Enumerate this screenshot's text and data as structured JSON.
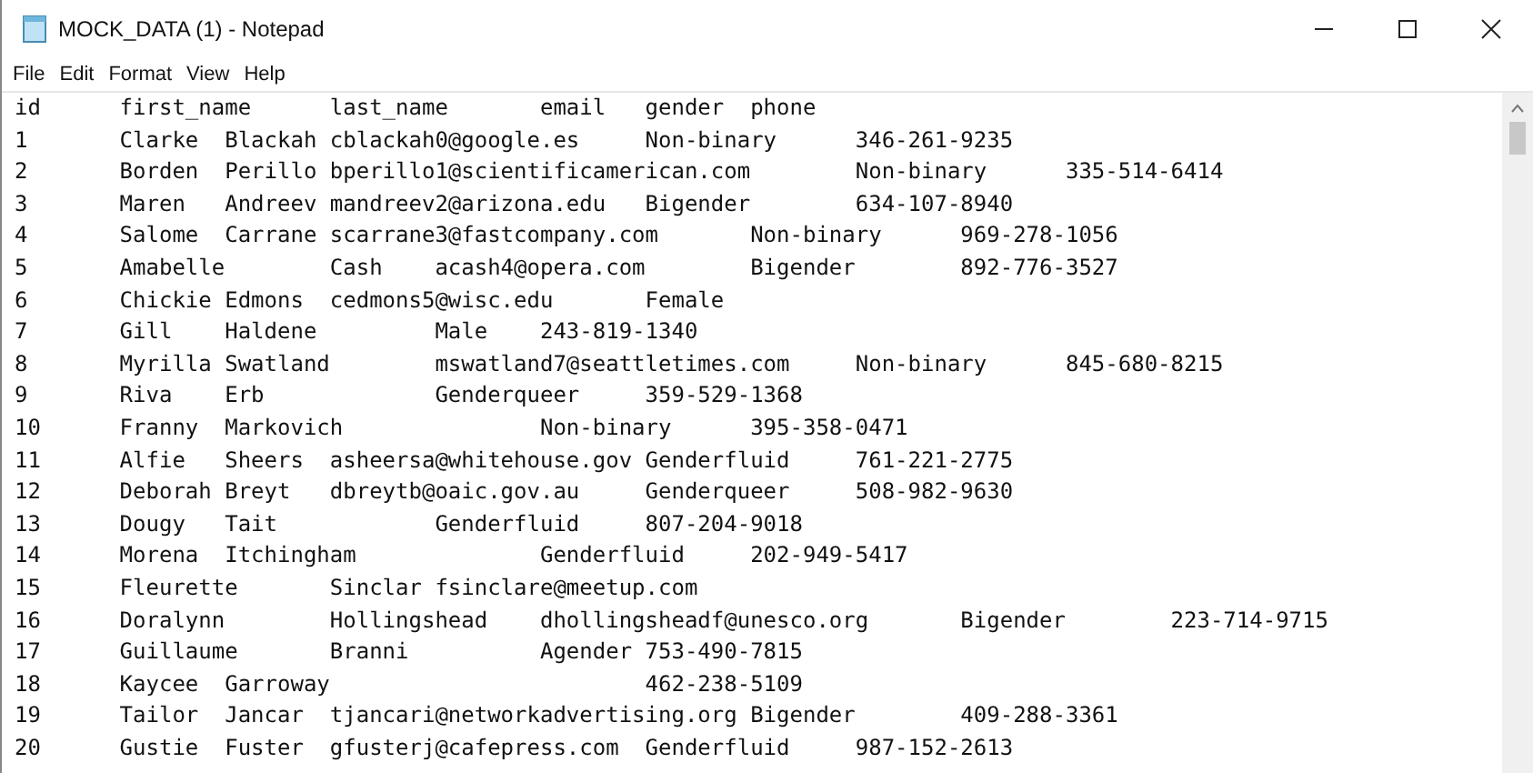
{
  "window": {
    "title": "MOCK_DATA (1) - Notepad"
  },
  "menu": [
    "File",
    "Edit",
    "Format",
    "View",
    "Help"
  ],
  "lines": [
    "id\tfirst_name\tlast_name\temail\tgender\tphone",
    "1\tClarke\tBlackah\tcblackah0@google.es\tNon-binary\t346-261-9235",
    "2\tBorden\tPerillo\tbperillo1@scientificamerican.com\tNon-binary\t335-514-6414",
    "3\tMaren\tAndreev\tmandreev2@arizona.edu\tBigender\t634-107-8940",
    "4\tSalome\tCarrane\tscarrane3@fastcompany.com\tNon-binary\t969-278-1056",
    "5\tAmabelle\tCash\tacash4@opera.com\tBigender\t892-776-3527",
    "6\tChickie\tEdmons\tcedmons5@wisc.edu\tFemale",
    "7\tGill\tHaldene\t\tMale\t243-819-1340",
    "8\tMyrilla\tSwatland\tmswatland7@seattletimes.com\tNon-binary\t845-680-8215",
    "9\tRiva\tErb\t\tGenderqueer\t359-529-1368",
    "10\tFranny\tMarkovich\t\tNon-binary\t395-358-0471",
    "11\tAlfie\tSheers\tasheersa@whitehouse.gov\tGenderfluid\t761-221-2775",
    "12\tDeborah\tBreyt\tdbreytb@oaic.gov.au\tGenderqueer\t508-982-9630",
    "13\tDougy\tTait\t\tGenderfluid\t807-204-9018",
    "14\tMorena\tItchingham\t\tGenderfluid\t202-949-5417",
    "15\tFleurette\tSinclar\tfsinclare@meetup.com",
    "16\tDoralynn\tHollingshead\tdhollingsheadf@unesco.org\tBigender\t223-714-9715",
    "17\tGuillaume\tBranni\t\tAgender\t753-490-7815",
    "18\tKaycee\tGarroway\t\t\t462-238-5109",
    "19\tTailor\tJancar\ttjancari@networkadvertising.org\tBigender\t409-288-3361",
    "20\tGustie\tFuster\tgfusterj@cafepress.com\tGenderfluid\t987-152-2613"
  ]
}
